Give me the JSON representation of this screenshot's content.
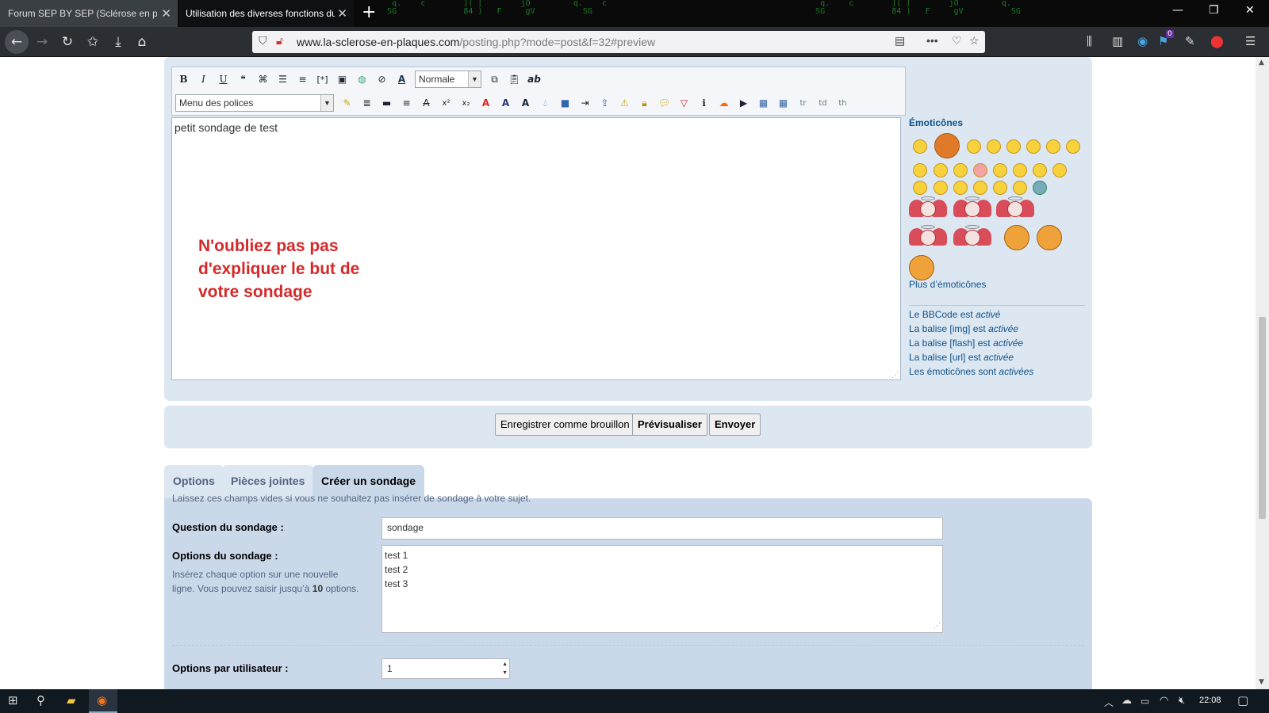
{
  "browser": {
    "tabs": [
      {
        "title": "Forum SEP BY SEP (Sclérose en plaques)",
        "active": false
      },
      {
        "title": "Utilisation des diverses fonctions du forum",
        "active": true
      }
    ],
    "url_domain": "www.la-sclerose-en-plaques.com",
    "url_rest": "/posting.php?mode=post&f=32#preview",
    "addon_badge": "0"
  },
  "editor": {
    "size_select": "Normale",
    "font_select": "Menu des polices",
    "message_text": "petit sondage de test",
    "overlay_note": "N'oubliez pas pas d'expliquer le but de votre sondage",
    "toolbar_row1": [
      "B",
      "I",
      "U"
    ],
    "toolbar_row2_tail": [
      "tr",
      "td",
      "th"
    ]
  },
  "smilies": {
    "heading": "Émoticônes",
    "more_link": "Plus d’émoticônes"
  },
  "status": {
    "bbcode": {
      "prefix": "Le ",
      "link": "BBCode",
      "mid": " est ",
      "state": "activé"
    },
    "img": {
      "text": "La balise [img] est ",
      "state": "activée"
    },
    "flash": {
      "text": "La balise [flash] est ",
      "state": "activée"
    },
    "url": {
      "text": "La balise [url] est ",
      "state": "activée"
    },
    "smilies": {
      "text": "Les émoticônes sont ",
      "state": "activées"
    }
  },
  "buttons": {
    "draft": "Enregistrer comme brouillon",
    "preview": "Prévisualiser",
    "submit": "Envoyer"
  },
  "panel_tabs": [
    "Options",
    "Pièces jointes",
    "Créer un sondage"
  ],
  "poll": {
    "intro": "Laissez ces champs vides si vous ne souhaitez pas insérer de sondage à votre sujet.",
    "question_label": "Question du sondage :",
    "question_value": "sondage",
    "options_label": "Options du sondage :",
    "options_hint_1": "Insérez chaque option sur une nouvelle",
    "options_hint_2a": "ligne. Vous pouvez saisir jusqu’à ",
    "options_hint_max": "10",
    "options_hint_2b": " options.",
    "options_values": [
      "test 1",
      "test 2",
      "test 3"
    ],
    "per_user_label": "Options par utilisateur :",
    "per_user_value": "1"
  },
  "taskbar": {
    "clock": "22:08"
  }
}
